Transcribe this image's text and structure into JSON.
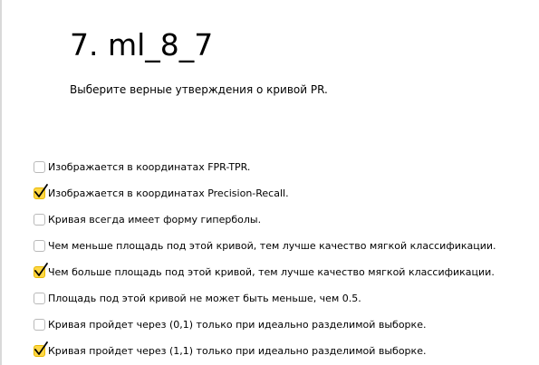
{
  "page": {
    "title": "7. ml_8_7",
    "question": "Выберите верные утверждения о кривой PR."
  },
  "options": [
    {
      "label": "Изображается в координатах FPR-TPR.",
      "checked": false
    },
    {
      "label": "Изображается в координатах Precision-Recall.",
      "checked": true
    },
    {
      "label": "Кривая всегда имеет форму гиперболы.",
      "checked": false
    },
    {
      "label": "Чем меньше площадь под этой кривой, тем лучше качество мягкой классификации.",
      "checked": false
    },
    {
      "label": "Чем больше площадь под этой кривой, тем лучше качество мягкой классификации.",
      "checked": true
    },
    {
      "label": "Площадь под этой кривой не может быть меньше, чем 0.5.",
      "checked": false
    },
    {
      "label": "Кривая пройдет через (0,1) только при идеально разделимой выборке.",
      "checked": false
    },
    {
      "label": "Кривая пройдет через (1,1) только при идеально разделимой выборке.",
      "checked": true
    }
  ],
  "colors": {
    "checked_fill": "#ffd744",
    "checkmark": "#000000",
    "unchecked_border": "#b9b9b9"
  },
  "icons": {
    "checked": "checkmark-icon"
  }
}
